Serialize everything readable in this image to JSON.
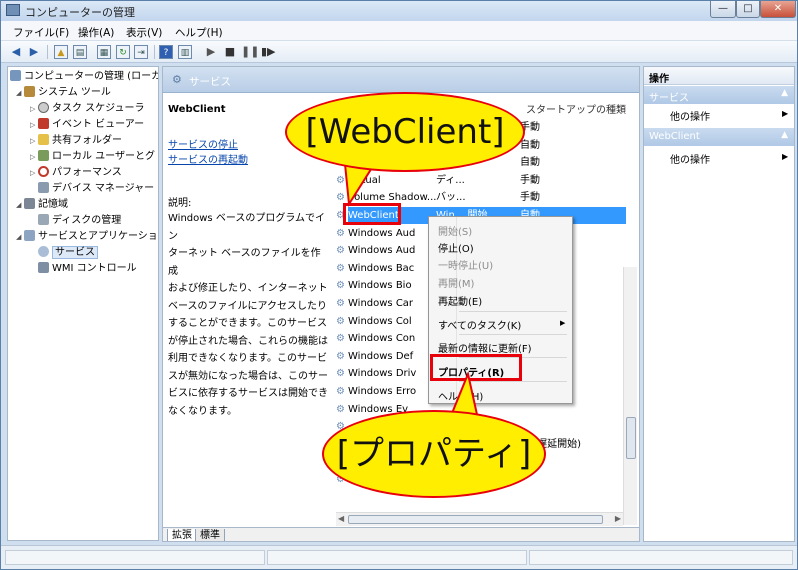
{
  "window": {
    "title": "コンピューターの管理"
  },
  "menu": [
    "ファイル(F)",
    "操作(A)",
    "表示(V)",
    "ヘルプ(H)"
  ],
  "tree": {
    "root": "コンピューターの管理 (ローカ",
    "items": [
      "システム ツール",
      "タスク スケジューラ",
      "イベント ビューアー",
      "共有フォルダー",
      "ローカル ユーザーとグ",
      "パフォーマンス",
      "デバイス マネージャー",
      "記憶域",
      "ディスクの管理",
      "サービスとアプリケーショ",
      "サービス",
      "WMI コントロール"
    ]
  },
  "center": {
    "header": "サービス",
    "selected_service": "WebClient",
    "links": [
      "サービスの停止",
      "サービスの再起動"
    ],
    "description_label": "説明:",
    "description_lines": [
      "Windows ベースのプログラムでイン",
      "ターネット ベースのファイルを作成",
      "および修正したり、インターネット",
      "ベースのファイルにアクセスしたり",
      "することができます。このサービス",
      "が停止された場合、これらの機能は",
      "利用できなくなります。このサービ",
      "スが無効になった場合は、このサー",
      "ビスに依存するサービスは開始でき",
      "なくなります。"
    ],
    "column_startup": "スタートアップの種類",
    "services": [
      {
        "name": "",
        "status": "",
        "startup": "手動"
      },
      {
        "name": "",
        "status": "",
        "startup": "自動"
      },
      {
        "name": "",
        "status": "",
        "startup": "自動"
      },
      {
        "name": "Virtual",
        "status": "ディ...",
        "startup": "手動"
      },
      {
        "name": "Volume Shadow...",
        "status": "バッ...",
        "startup": "手動"
      },
      {
        "name": "WebClient",
        "status": "Win...  開始",
        "startup": "自動"
      },
      {
        "name": "Windows Aud",
        "status": "",
        "startup": ""
      },
      {
        "name": "Windows Aud",
        "status": "",
        "startup": ""
      },
      {
        "name": "Windows Bac",
        "status": "",
        "startup": ""
      },
      {
        "name": "Windows Bio",
        "status": "",
        "startup": ""
      },
      {
        "name": "Windows Car",
        "status": "",
        "startup": ""
      },
      {
        "name": "Windows Col",
        "status": "",
        "startup": ""
      },
      {
        "name": "Windows Con",
        "status": "",
        "startup": ""
      },
      {
        "name": "Windows Def",
        "status": "",
        "startup": "開始)"
      },
      {
        "name": "Windows Driv",
        "status": "",
        "startup": ""
      },
      {
        "name": "Windows Erro",
        "status": "",
        "startup": ""
      },
      {
        "name": "Windows Ev",
        "status": "",
        "startup": ""
      },
      {
        "name": "",
        "status": "",
        "startup": ""
      },
      {
        "name": "",
        "status": "",
        "startup": "動 (遅延開始)"
      },
      {
        "name": "Windows",
        "status": "",
        "startup": "手動"
      },
      {
        "name": "",
        "status": "",
        "startup": ""
      }
    ],
    "tabs": [
      "拡張",
      "標準"
    ]
  },
  "context_menu": {
    "items": [
      {
        "label": "開始(S)",
        "disabled": true
      },
      {
        "label": "停止(O)",
        "disabled": false
      },
      {
        "label": "一時停止(U)",
        "disabled": true
      },
      {
        "label": "再開(M)",
        "disabled": true
      },
      {
        "label": "再起動(E)",
        "disabled": false
      },
      {
        "label": "すべてのタスク(K)",
        "disabled": false
      },
      {
        "label": "最新の情報に更新(F)",
        "disabled": false
      },
      {
        "label": "プロパティ(R)",
        "disabled": false
      },
      {
        "label": "ヘルプ(H)",
        "disabled": false
      }
    ]
  },
  "actions": {
    "title": "操作",
    "sections": [
      {
        "header": "サービス",
        "item": "他の操作"
      },
      {
        "header": "WebClient",
        "item": "他の操作"
      }
    ]
  },
  "callouts": {
    "top": "[WebClient]",
    "bottom": "[プロパティ]"
  },
  "colors": {
    "callout_fill": "#ffee00",
    "highlight_border": "#e8000b",
    "selection": "#3399ff"
  }
}
